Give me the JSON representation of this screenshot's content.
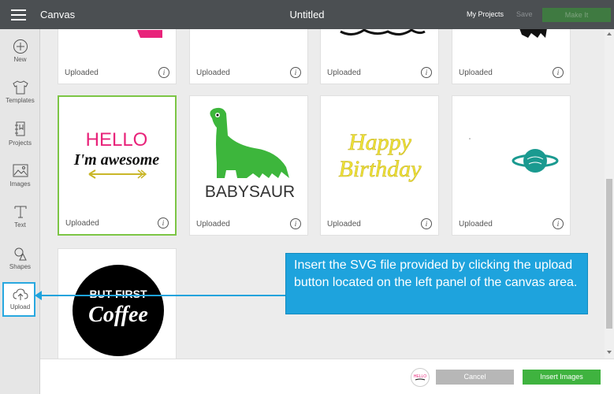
{
  "header": {
    "app_title": "Canvas",
    "doc_title": "Untitled",
    "my_projects": "My Projects",
    "save": "Save",
    "make": "Make It"
  },
  "sidebar": {
    "items": [
      {
        "label": "New",
        "icon": "plus-circle-icon"
      },
      {
        "label": "Templates",
        "icon": "tshirt-icon"
      },
      {
        "label": "Projects",
        "icon": "projects-icon"
      },
      {
        "label": "Images",
        "icon": "image-icon"
      },
      {
        "label": "Text",
        "icon": "text-icon"
      },
      {
        "label": "Shapes",
        "icon": "shapes-icon"
      },
      {
        "label": "Upload",
        "icon": "upload-icon"
      }
    ]
  },
  "gallery": {
    "cards": [
      {
        "label": "Uploaded",
        "art": "pink-partial"
      },
      {
        "label": "Uploaded",
        "art": "blank"
      },
      {
        "label": "Uploaded",
        "art": "script-partial"
      },
      {
        "label": "Uploaded",
        "art": "black-partial"
      },
      {
        "label": "Uploaded",
        "art": "hello-awesome",
        "line1": "HELLO",
        "line2": "I'm awesome"
      },
      {
        "label": "Uploaded",
        "art": "babysaur",
        "text": "BABYSAUR"
      },
      {
        "label": "Uploaded",
        "art": "happy-birthday",
        "line1": "Happy",
        "line2": "Birthday"
      },
      {
        "label": "Uploaded",
        "art": "planet"
      },
      {
        "label": "",
        "art": "but-first-coffee",
        "line1": "BUT FIRST",
        "line2": "Coffee"
      }
    ]
  },
  "callout": {
    "text": "Insert the SVG file provided by clicking the upload button located on the left panel of the canvas area."
  },
  "footer": {
    "cancel": "Cancel",
    "insert": "Insert Images"
  },
  "colors": {
    "topbar": "#4b4f52",
    "accent_blue": "#1ea3dd",
    "insert_green": "#3fb33f",
    "selected_border": "#7cc545"
  }
}
